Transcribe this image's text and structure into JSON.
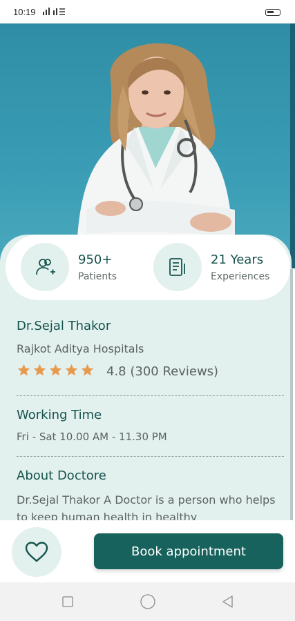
{
  "status_bar": {
    "time": "10:19",
    "signal": "¹√▐▐ ≡"
  },
  "stats": {
    "patients": {
      "value": "950+",
      "label": "Patients",
      "icon": "add-user-icon"
    },
    "experience": {
      "value": "21 Years",
      "label": "Experiences",
      "icon": "document-icon"
    }
  },
  "doctor": {
    "name": "Dr.Sejal Thakor",
    "hospital": "Rajkot Aditya Hospitals",
    "rating_text": "4.8 (300 Reviews)",
    "stars": 5
  },
  "working": {
    "title": "Working Time",
    "hours": "Fri - Sat 10.00 AM - 11.30 PM"
  },
  "about": {
    "title": "About Doctore",
    "text": "Dr.Sejal Thakor A Doctor is a person who helps to keep human health in healthy"
  },
  "actions": {
    "favorite_icon": "heart-icon",
    "book_label": "Book appointment"
  },
  "colors": {
    "primary": "#17625c",
    "panel": "#e2f0ee",
    "hero": "#3a9db5",
    "star": "#e89a4c"
  }
}
